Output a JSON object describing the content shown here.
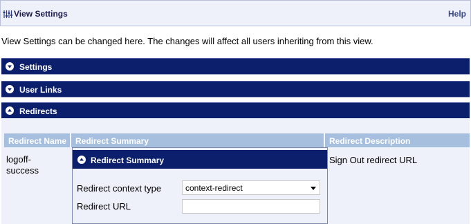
{
  "header": {
    "title": "View Settings",
    "icon": "settings-sliders-icon",
    "help_label": "Help"
  },
  "intro_text": "View Settings can be changed here. The changes will affect all users inheriting from this view.",
  "sections": [
    {
      "label": "Settings",
      "icon": "chevron-down-circle-icon",
      "expanded": false
    },
    {
      "label": "User Links",
      "icon": "chevron-down-circle-icon",
      "expanded": false
    },
    {
      "label": "Redirects",
      "icon": "chevron-up-circle-icon",
      "expanded": true
    }
  ],
  "redirects_table": {
    "columns": [
      "Redirect Name",
      "Redirect Summary",
      "Redirect Description"
    ],
    "rows": [
      {
        "name": "logoff-\nsuccess",
        "description": "Sign Out redirect URL"
      }
    ]
  },
  "summary_popup": {
    "title": "Redirect Summary",
    "icon": "chevron-up-circle-icon",
    "context_type_label": "Redirect context type",
    "context_type_value": "context-redirect",
    "url_label": "Redirect URL",
    "url_value": ""
  },
  "colors": {
    "section_bar": "#0c1f6c",
    "table_header": "#a6bfdf",
    "panel_background": "#eef0fa"
  }
}
